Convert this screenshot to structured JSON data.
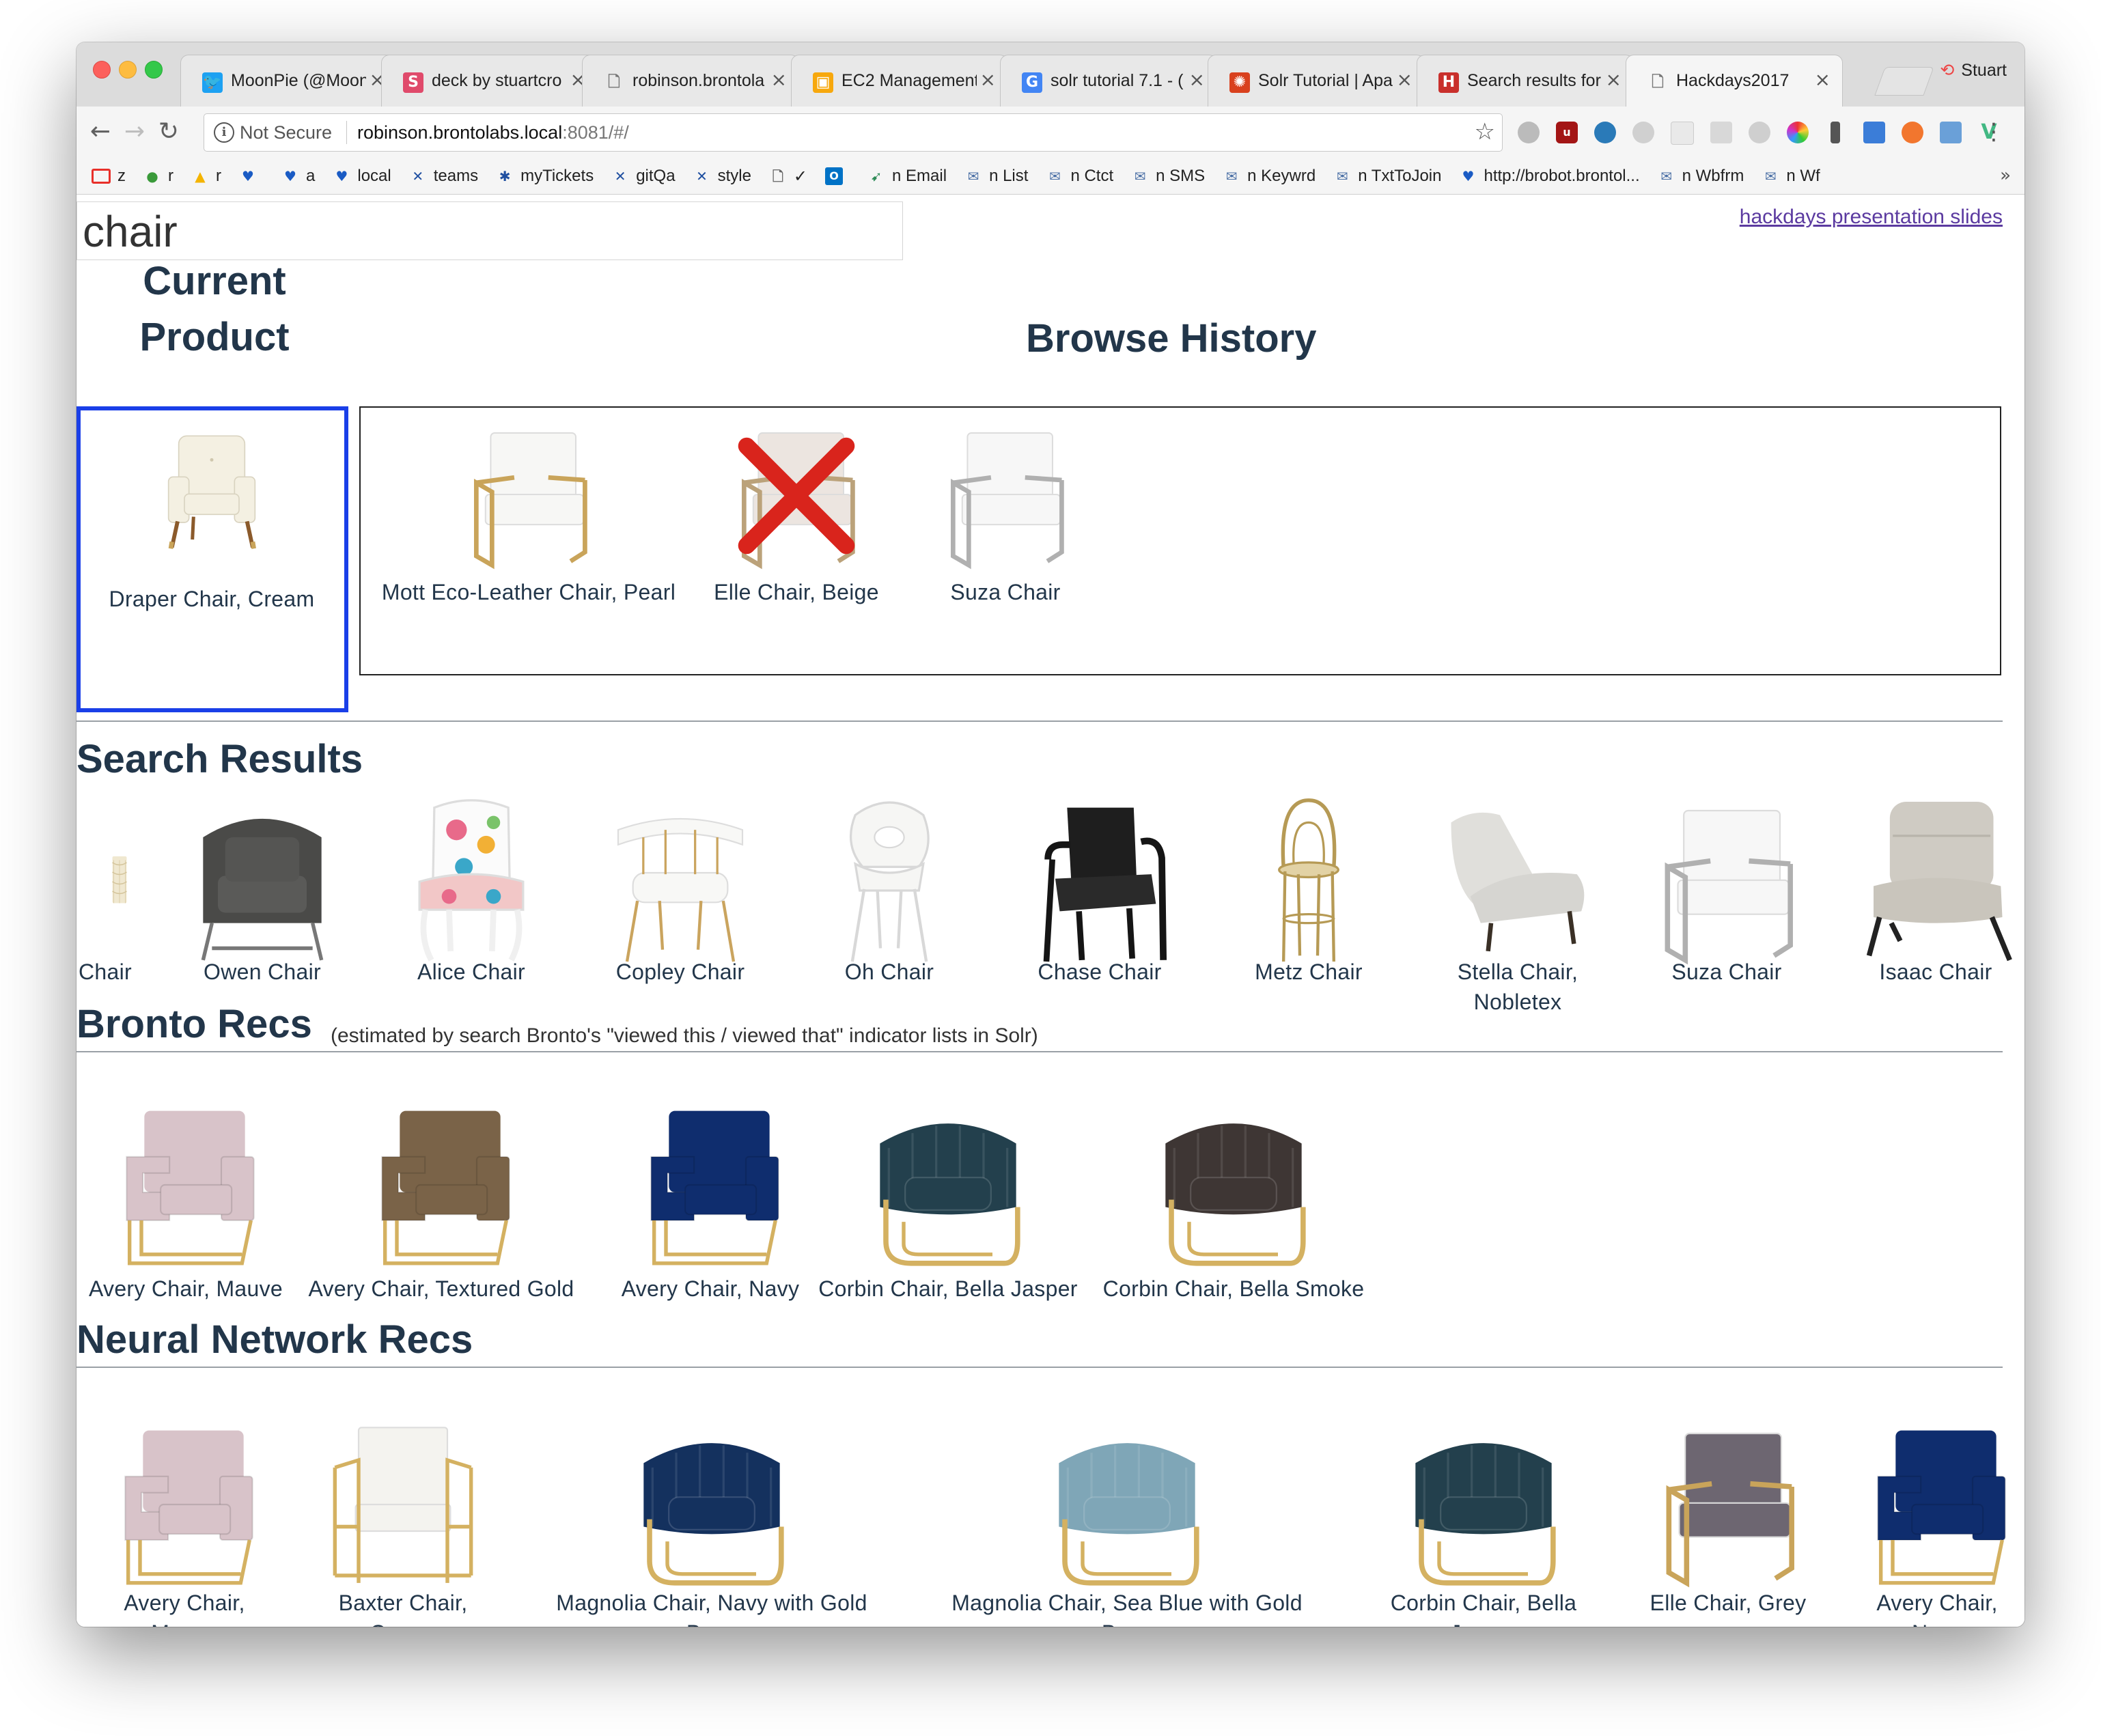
{
  "browser": {
    "tabs": [
      {
        "label": "MoonPie (@Moon",
        "favicon": "twitter-icon",
        "color": "#1da1f2",
        "glyph": "🐦"
      },
      {
        "label": "deck by stuartcro",
        "favicon": "s-icon",
        "color": "#e04a6b",
        "glyph": "S"
      },
      {
        "label": "robinson.brontola",
        "favicon": "page-icon",
        "color": "#ffffff",
        "glyph": "🗋"
      },
      {
        "label": "EC2 Management",
        "favicon": "aws-icon",
        "color": "#f7a80d",
        "glyph": "▣"
      },
      {
        "label": "solr tutorial 7.1 - (",
        "favicon": "google-icon",
        "color": "#4285f4",
        "glyph": "G"
      },
      {
        "label": "Solr Tutorial | Apa",
        "favicon": "solr-icon",
        "color": "#d9411e",
        "glyph": "✺"
      },
      {
        "label": "Search results for",
        "favicon": "hf-icon",
        "color": "#c9302c",
        "glyph": "H"
      },
      {
        "label": "Hackdays2017",
        "favicon": "page-icon",
        "color": "#ffffff",
        "glyph": "🗋"
      }
    ],
    "profile_name": "Stuart",
    "url_security": "Not Secure",
    "url_host": "robinson.brontolabs.local",
    "url_rest": ":8081/#/",
    "bookmarks": [
      {
        "label": "z",
        "icon": "red-square-icon",
        "color": "#e8302a",
        "glyph": "▭"
      },
      {
        "label": "r",
        "icon": "green-pin-icon",
        "color": "#3a9a3a",
        "glyph": "●"
      },
      {
        "label": "r",
        "icon": "drive-icon",
        "color": "#f4b400",
        "glyph": "▲"
      },
      {
        "label": "",
        "icon": "heart-icon",
        "color": "#1a5bc4",
        "glyph": "♥"
      },
      {
        "label": "a",
        "icon": "heart-icon",
        "color": "#1a5bc4",
        "glyph": "♥"
      },
      {
        "label": "local",
        "icon": "heart-icon",
        "color": "#1a5bc4",
        "glyph": "♥"
      },
      {
        "label": "teams",
        "icon": "jira-icon",
        "color": "#1f4fa0",
        "glyph": "✕"
      },
      {
        "label": "myTickets",
        "icon": "bug-icon",
        "color": "#1f4fa0",
        "glyph": "✱"
      },
      {
        "label": "gitQa",
        "icon": "jira-icon",
        "color": "#1f4fa0",
        "glyph": "✕"
      },
      {
        "label": "style",
        "icon": "jira-icon",
        "color": "#1f4fa0",
        "glyph": "✕"
      },
      {
        "label": "✓",
        "icon": "page-icon",
        "color": "#666666",
        "glyph": "🗋"
      },
      {
        "label": "",
        "icon": "outlook-icon",
        "color": "#0072c6",
        "glyph": "O"
      },
      {
        "label": "n Email",
        "icon": "dino-icon",
        "color": "#2e8b57",
        "glyph": "➹"
      },
      {
        "label": "n List",
        "icon": "mail-icon",
        "color": "#4a6fa5",
        "glyph": "✉"
      },
      {
        "label": "n Ctct",
        "icon": "mail-icon",
        "color": "#4a6fa5",
        "glyph": "✉"
      },
      {
        "label": "n SMS",
        "icon": "mail-icon",
        "color": "#4a6fa5",
        "glyph": "✉"
      },
      {
        "label": "n Keywrd",
        "icon": "mail-icon",
        "color": "#4a6fa5",
        "glyph": "✉"
      },
      {
        "label": "n TxtToJoin",
        "icon": "mail-icon",
        "color": "#4a6fa5",
        "glyph": "✉"
      },
      {
        "label": "http://brobot.brontol...",
        "icon": "heart-icon",
        "color": "#1a5bc4",
        "glyph": "♥"
      },
      {
        "label": "n Wbfrm",
        "icon": "mail-icon",
        "color": "#4a6fa5",
        "glyph": "✉"
      },
      {
        "label": "n Wf",
        "icon": "mail-icon",
        "color": "#4a6fa5",
        "glyph": "✉"
      }
    ]
  },
  "page": {
    "search_value": "chair",
    "slides_link": "hackdays presentation slides",
    "current_heading_line1": "Current",
    "current_heading_line2": "Product",
    "history_heading": "Browse History",
    "current_product": {
      "name": "Draper Chair, Cream",
      "style": "armchair",
      "seat": "#f4f0e2",
      "frame": "#8b5a2b"
    },
    "history": [
      {
        "name": "Mott Eco-Leather Chair, Pearl",
        "style": "frame",
        "seat": "#f7f7f5",
        "frame": "#c9a45a"
      },
      {
        "name": "Elle Chair, Beige",
        "style": "frame",
        "seat": "#ece5e0",
        "frame": "#bba27a",
        "crossed": true
      },
      {
        "name": "Suza Chair",
        "style": "frame",
        "seat": "#f7f7f7",
        "frame": "#b0b0b0"
      }
    ],
    "search_title": "Search Results",
    "search_results": [
      {
        "name": "Chair",
        "style": "screen",
        "seat": "#e8dcc0",
        "frame": "#d4c49a"
      },
      {
        "name": "Owen Chair",
        "style": "tub",
        "seat": "#4a4a48",
        "frame": "#777"
      },
      {
        "name": "Alice Chair",
        "style": "floral",
        "seat": "#f2c7c7",
        "frame": "#f5f5f5"
      },
      {
        "name": "Copley Chair",
        "style": "dining",
        "seat": "#f8f8f6",
        "frame": "#caa45e"
      },
      {
        "name": "Oh Chair",
        "style": "shell",
        "seat": "#f6f6f4",
        "frame": "#d8d8d8"
      },
      {
        "name": "Chase Chair",
        "style": "lounge",
        "seat": "#1e1e1e",
        "frame": "#151515"
      },
      {
        "name": "Metz Chair",
        "style": "bistro",
        "seat": "#e2d2a5",
        "frame": "#b69a55"
      },
      {
        "name": "Stella Chair, Nobletex",
        "style": "slant",
        "seat": "#e0dfdb",
        "frame": "#3a3026"
      },
      {
        "name": "Suza Chair",
        "style": "frame",
        "seat": "#f7f7f7",
        "frame": "#b0b0b0"
      },
      {
        "name": "Isaac Chair",
        "style": "slipper",
        "seat": "#cfcbc3",
        "frame": "#222"
      }
    ],
    "bronto_title": "Bronto Recs",
    "bronto_note": "(estimated by search Bronto's \"viewed this / viewed that\" indicator lists in Solr)",
    "bronto_recs": [
      {
        "name": "Avery Chair, Mauve",
        "style": "block",
        "seat": "#d8c3c9",
        "frame": "#d4b161"
      },
      {
        "name": "Avery Chair, Textured Gold",
        "style": "block",
        "seat": "#7a6348",
        "frame": "#d4b161"
      },
      {
        "name": "Avery Chair, Navy",
        "style": "block",
        "seat": "#0f2d6e",
        "frame": "#d4b161"
      },
      {
        "name": "Corbin Chair, Bella Jasper",
        "style": "barrel",
        "seat": "#23404d",
        "frame": "#d4b161"
      },
      {
        "name": "Corbin Chair, Bella Smoke",
        "style": "barrel",
        "seat": "#3e3634",
        "frame": "#d4b161"
      }
    ],
    "neural_title": "Neural Network Recs",
    "neural_recs": [
      {
        "name": "Avery Chair, Mauve",
        "style": "block",
        "seat": "#d8c3c9",
        "frame": "#d4b161"
      },
      {
        "name": "Baxter Chair, Cream",
        "style": "cube",
        "seat": "#f4f3ef",
        "frame": "#d4b161"
      },
      {
        "name": "Magnolia Chair, Navy with Gold Base",
        "style": "barrel",
        "seat": "#14315e",
        "frame": "#d4b161"
      },
      {
        "name": "Magnolia Chair, Sea Blue with Gold Base",
        "style": "barrel",
        "seat": "#7fa6b7",
        "frame": "#d4b161"
      },
      {
        "name": "Corbin Chair, Bella Jasper",
        "style": "barrel",
        "seat": "#23404d",
        "frame": "#d4b161"
      },
      {
        "name": "Elle Chair, Grey",
        "style": "frame",
        "seat": "#6d6671",
        "frame": "#c9a45a"
      },
      {
        "name": "Avery Chair, Navy",
        "style": "block",
        "seat": "#0f2d6e",
        "frame": "#d4b161"
      }
    ]
  }
}
